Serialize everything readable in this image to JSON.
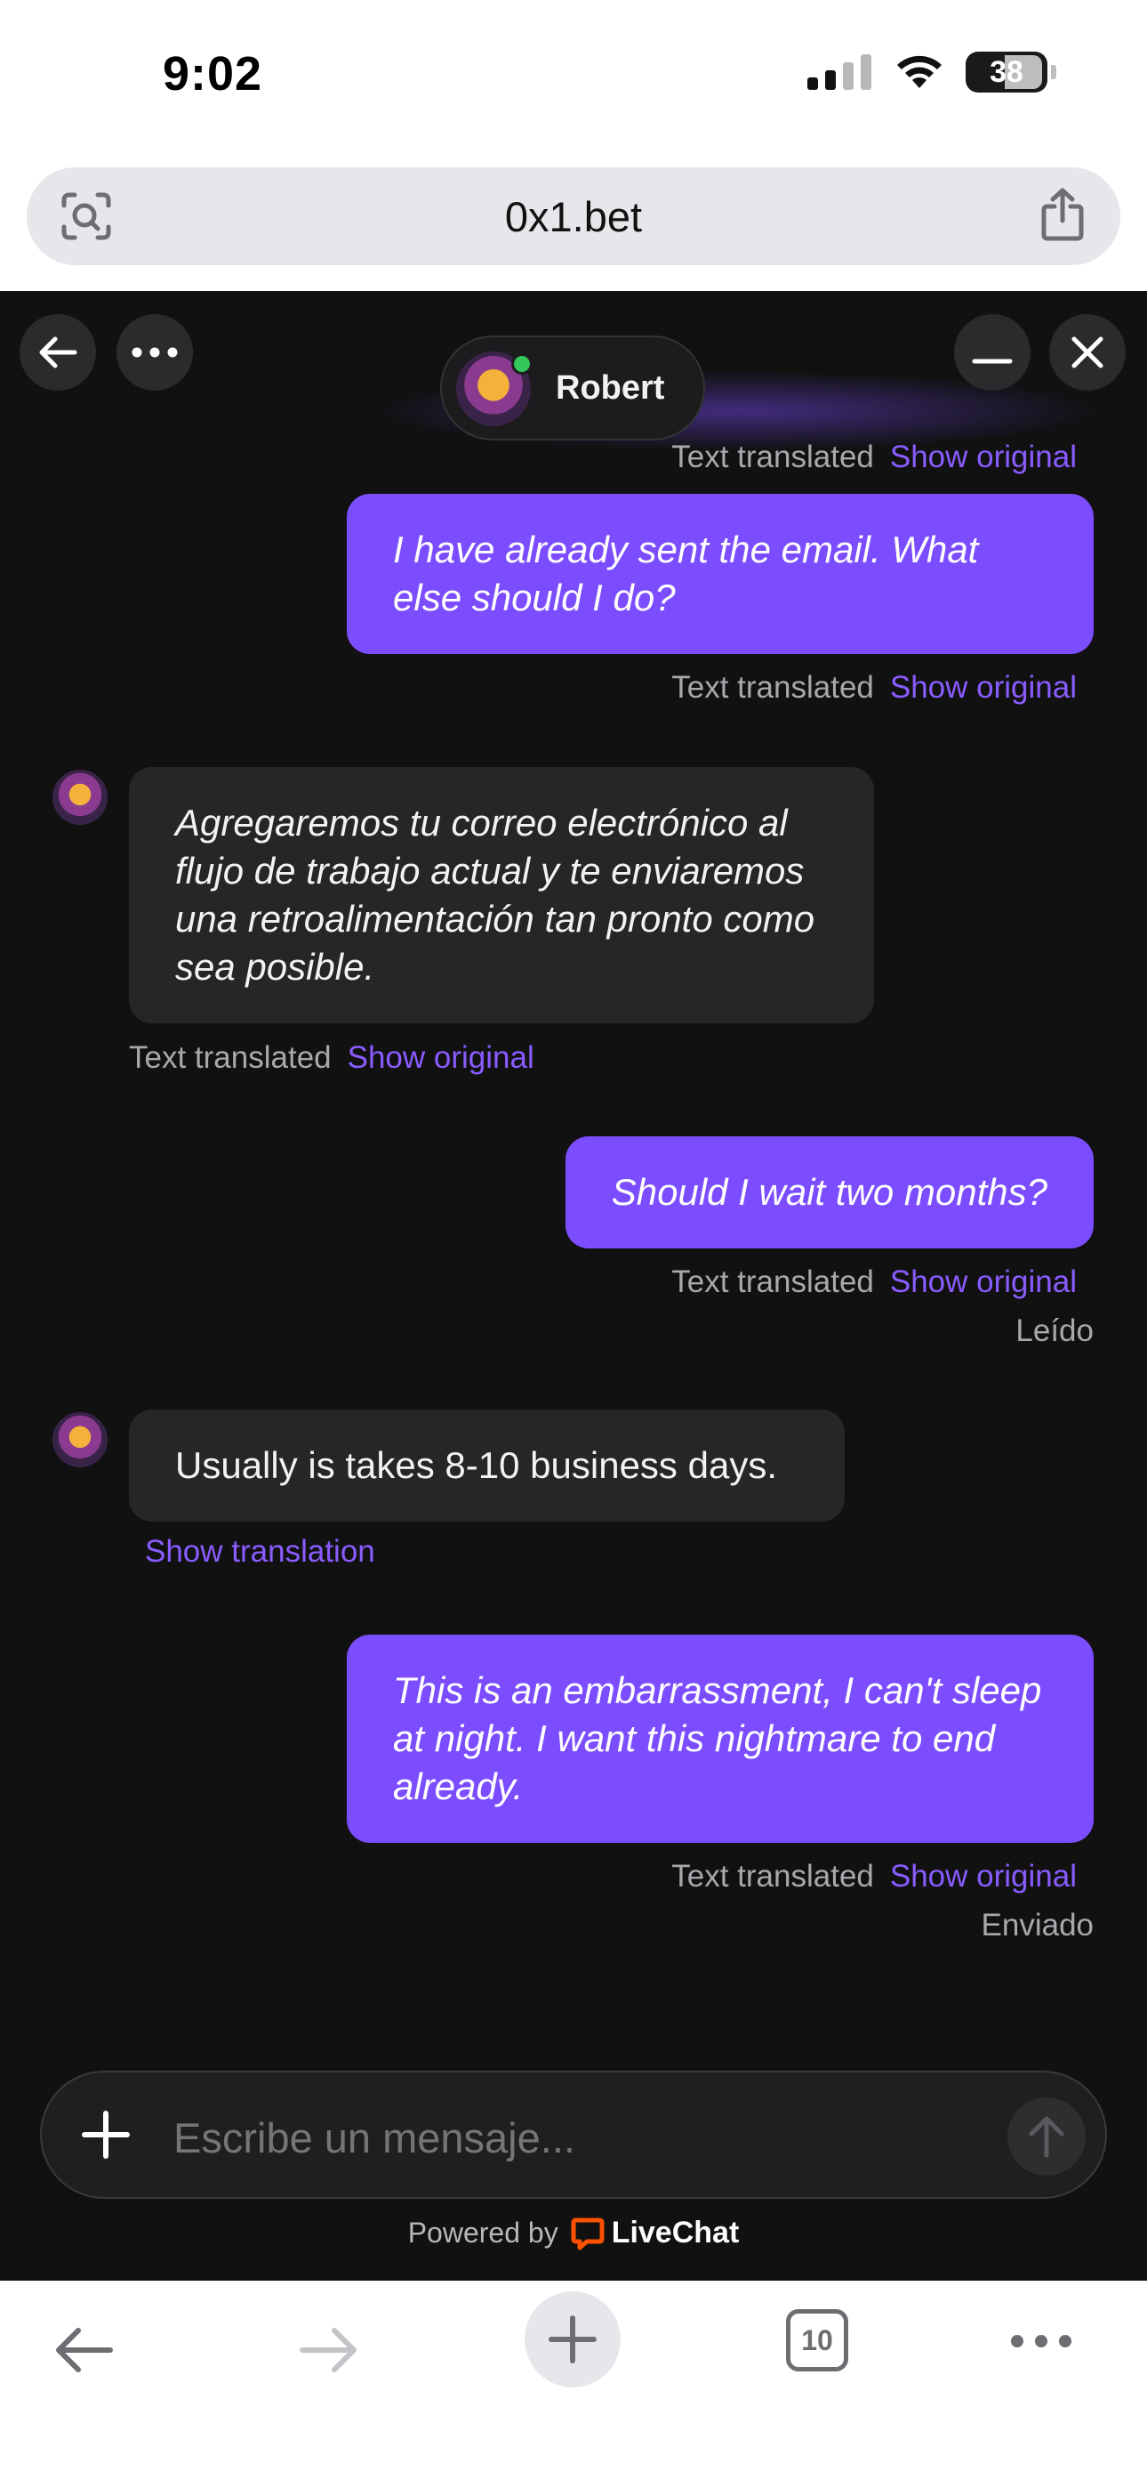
{
  "status_bar": {
    "time": "9:02",
    "battery": "38"
  },
  "browser": {
    "url": "0x1.bet",
    "tabs_count": "10"
  },
  "chat": {
    "agent_name": "Robert",
    "messages": [
      {
        "direction": "outgoing",
        "partial": true,
        "meta": "Text translated",
        "link": "Show original"
      },
      {
        "direction": "outgoing",
        "text": "I have already sent the email. What else should I do?",
        "meta": "Text translated",
        "link": "Show original"
      },
      {
        "direction": "incoming",
        "text": "Agregaremos tu correo electrónico al flujo de trabajo actual y te enviaremos una retroalimentación tan pronto como sea posible.",
        "meta": "Text translated",
        "link": "Show original"
      },
      {
        "direction": "outgoing",
        "text": "Should I wait two months?",
        "meta": "Text translated",
        "link": "Show original",
        "status": "Leído"
      },
      {
        "direction": "incoming",
        "text": "Usually is takes 8-10 business days.",
        "link": "Show translation"
      },
      {
        "direction": "outgoing",
        "text": "This is an embarrassment, I can't sleep at night. I want this nightmare to end already.",
        "meta": "Text translated",
        "link": "Show original",
        "status": "Enviado"
      }
    ],
    "composer_placeholder": "Escribe un mensaje...",
    "powered_by": "Powered by",
    "brand": "LiveChat"
  },
  "icons": {
    "address_left": "visual-lookup-icon",
    "address_right": "share-icon",
    "chat_back": "back-arrow-icon",
    "chat_more": "more-dots-icon",
    "chat_minimize": "minimize-icon",
    "chat_close": "close-icon"
  },
  "colors": {
    "accent": "#7c4dff",
    "link": "#8a5cff",
    "chat_bg": "#111112",
    "incoming_bubble": "#262628"
  }
}
